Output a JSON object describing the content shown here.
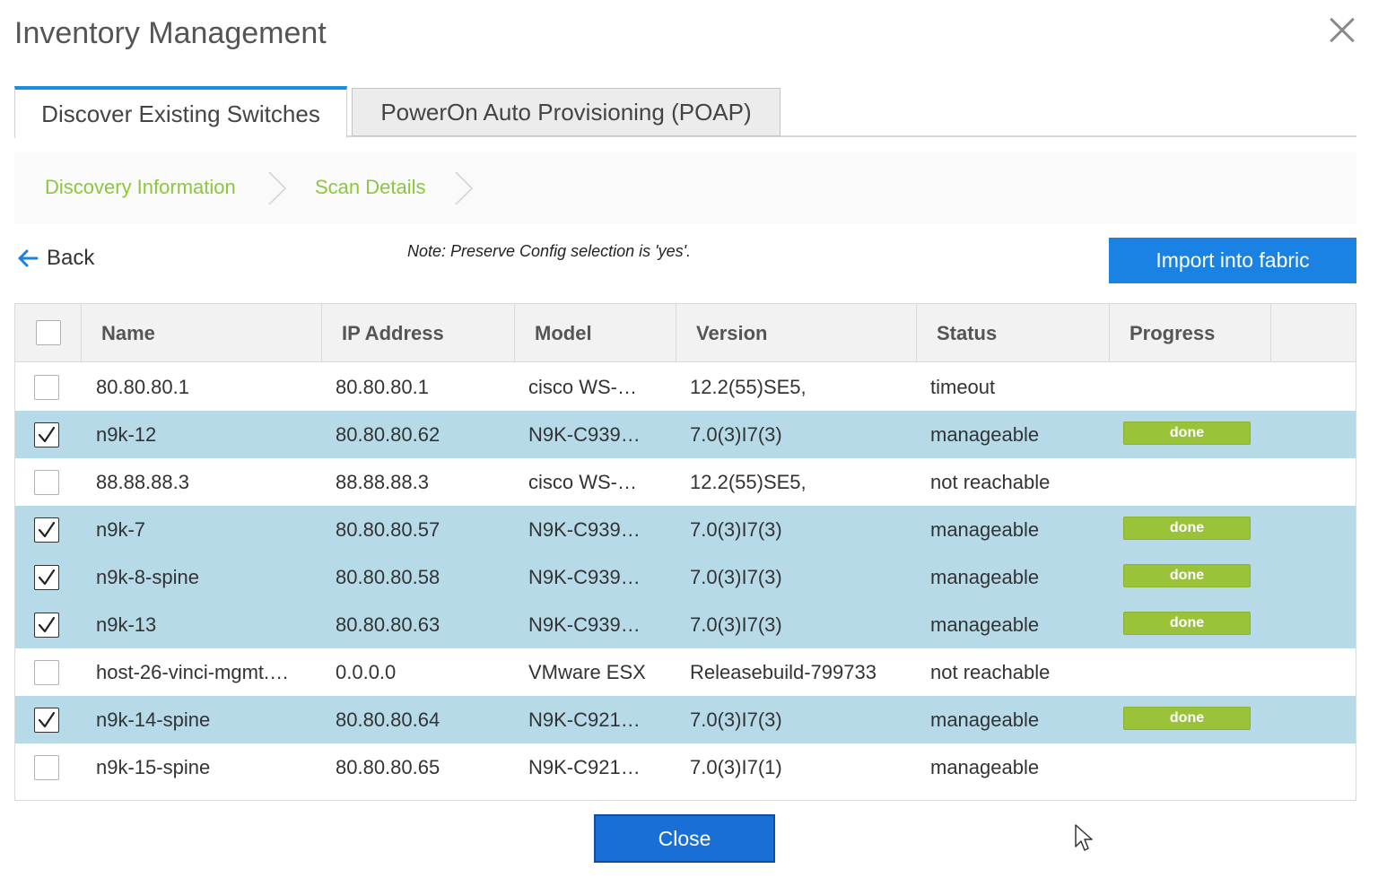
{
  "window": {
    "title": "Inventory Management"
  },
  "tabs": [
    {
      "label": "Discover Existing Switches",
      "active": true
    },
    {
      "label": "PowerOn Auto Provisioning (POAP)",
      "active": false
    }
  ],
  "steps": [
    {
      "label": "Discovery Information"
    },
    {
      "label": "Scan Details"
    }
  ],
  "toolbar": {
    "back_label": "Back",
    "note": "Note: Preserve Config selection is 'yes'.",
    "import_label": "Import into fabric"
  },
  "table": {
    "columns": [
      "Name",
      "IP Address",
      "Model",
      "Version",
      "Status",
      "Progress"
    ],
    "rows": [
      {
        "checked": false,
        "name": "80.80.80.1",
        "ip": "80.80.80.1",
        "model": "cisco WS-…",
        "version": "12.2(55)SE5,",
        "status": "timeout",
        "progress": ""
      },
      {
        "checked": true,
        "name": "n9k-12",
        "ip": "80.80.80.62",
        "model": "N9K-C939…",
        "version": "7.0(3)I7(3)",
        "status": "manageable",
        "progress": "done"
      },
      {
        "checked": false,
        "name": "88.88.88.3",
        "ip": "88.88.88.3",
        "model": "cisco WS-…",
        "version": "12.2(55)SE5,",
        "status": "not reachable",
        "progress": ""
      },
      {
        "checked": true,
        "name": "n9k-7",
        "ip": "80.80.80.57",
        "model": "N9K-C939…",
        "version": "7.0(3)I7(3)",
        "status": "manageable",
        "progress": "done"
      },
      {
        "checked": true,
        "name": "n9k-8-spine",
        "ip": "80.80.80.58",
        "model": "N9K-C939…",
        "version": "7.0(3)I7(3)",
        "status": "manageable",
        "progress": "done"
      },
      {
        "checked": true,
        "name": "n9k-13",
        "ip": "80.80.80.63",
        "model": "N9K-C939…",
        "version": "7.0(3)I7(3)",
        "status": "manageable",
        "progress": "done"
      },
      {
        "checked": false,
        "name": "host-26-vinci-mgmt.…",
        "ip": "0.0.0.0",
        "model": "VMware ESX",
        "version": "Releasebuild-799733",
        "status": "not reachable",
        "progress": ""
      },
      {
        "checked": true,
        "name": "n9k-14-spine",
        "ip": "80.80.80.64",
        "model": "N9K-C921…",
        "version": "7.0(3)I7(3)",
        "status": "manageable",
        "progress": "done"
      },
      {
        "checked": false,
        "name": "n9k-15-spine",
        "ip": "80.80.80.65",
        "model": "N9K-C921…",
        "version": "7.0(3)I7(1)",
        "status": "manageable",
        "progress": ""
      }
    ]
  },
  "footer": {
    "close_label": "Close"
  },
  "colors": {
    "accent": "#1a82e2",
    "step_green": "#8dc63f",
    "selected_row": "#b6dae8",
    "badge_green": "#9ac33a"
  }
}
